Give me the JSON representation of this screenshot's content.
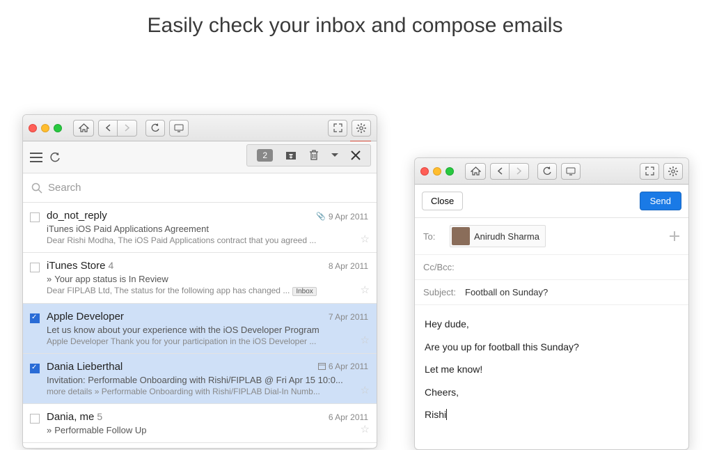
{
  "headline": "Easily check your inbox and compose emails",
  "search_placeholder": "Search",
  "selection_count": "2",
  "inbox_label": "Inbox",
  "messages": [
    {
      "sender": "do_not_reply",
      "count": "",
      "date": "9 Apr 2011",
      "attachment": true,
      "subject": "iTunes iOS Paid Applications Agreement",
      "preview": "Dear Rishi Modha, The iOS Paid Applications contract that you agreed ...",
      "selected": false
    },
    {
      "sender": "iTunes Store",
      "count": "4",
      "date": "8 Apr 2011",
      "attachment": false,
      "subject": "Your app status is In Review",
      "preview": "Dear FIPLAB Ltd, The status for the following app has changed ...",
      "selected": false,
      "label": "Inbox",
      "caret": true
    },
    {
      "sender": "Apple Developer",
      "count": "",
      "date": "7 Apr 2011",
      "attachment": false,
      "subject": "Let us know about your experience with the iOS Developer Program",
      "preview": "Apple Developer Thank you for your participation in the iOS Developer ...",
      "selected": true
    },
    {
      "sender": "Dania Lieberthal",
      "count": "",
      "date": "6 Apr 2011",
      "attachment": false,
      "calendar": true,
      "subject": "Invitation: Performable Onboarding with Rishi/FIPLAB @ Fri Apr 15 10:0...",
      "preview": "more details » Performable Onboarding with Rishi/FIPLAB Dial-In Numb...",
      "selected": true
    },
    {
      "sender": "Dania, me",
      "count": "5",
      "date": "6 Apr 2011",
      "attachment": false,
      "subject": "Performable Follow Up",
      "preview": "",
      "selected": false,
      "caret": true
    }
  ],
  "compose": {
    "close": "Close",
    "send": "Send",
    "to_label": "To:",
    "recipient": "Anirudh Sharma",
    "ccbcc": "Cc/Bcc:",
    "subject_label": "Subject:",
    "subject": "Football on Sunday?",
    "body": [
      "Hey dude,",
      "Are you up for football this Sunday?",
      "Let me know!",
      "Cheers,",
      "Rishi"
    ]
  }
}
